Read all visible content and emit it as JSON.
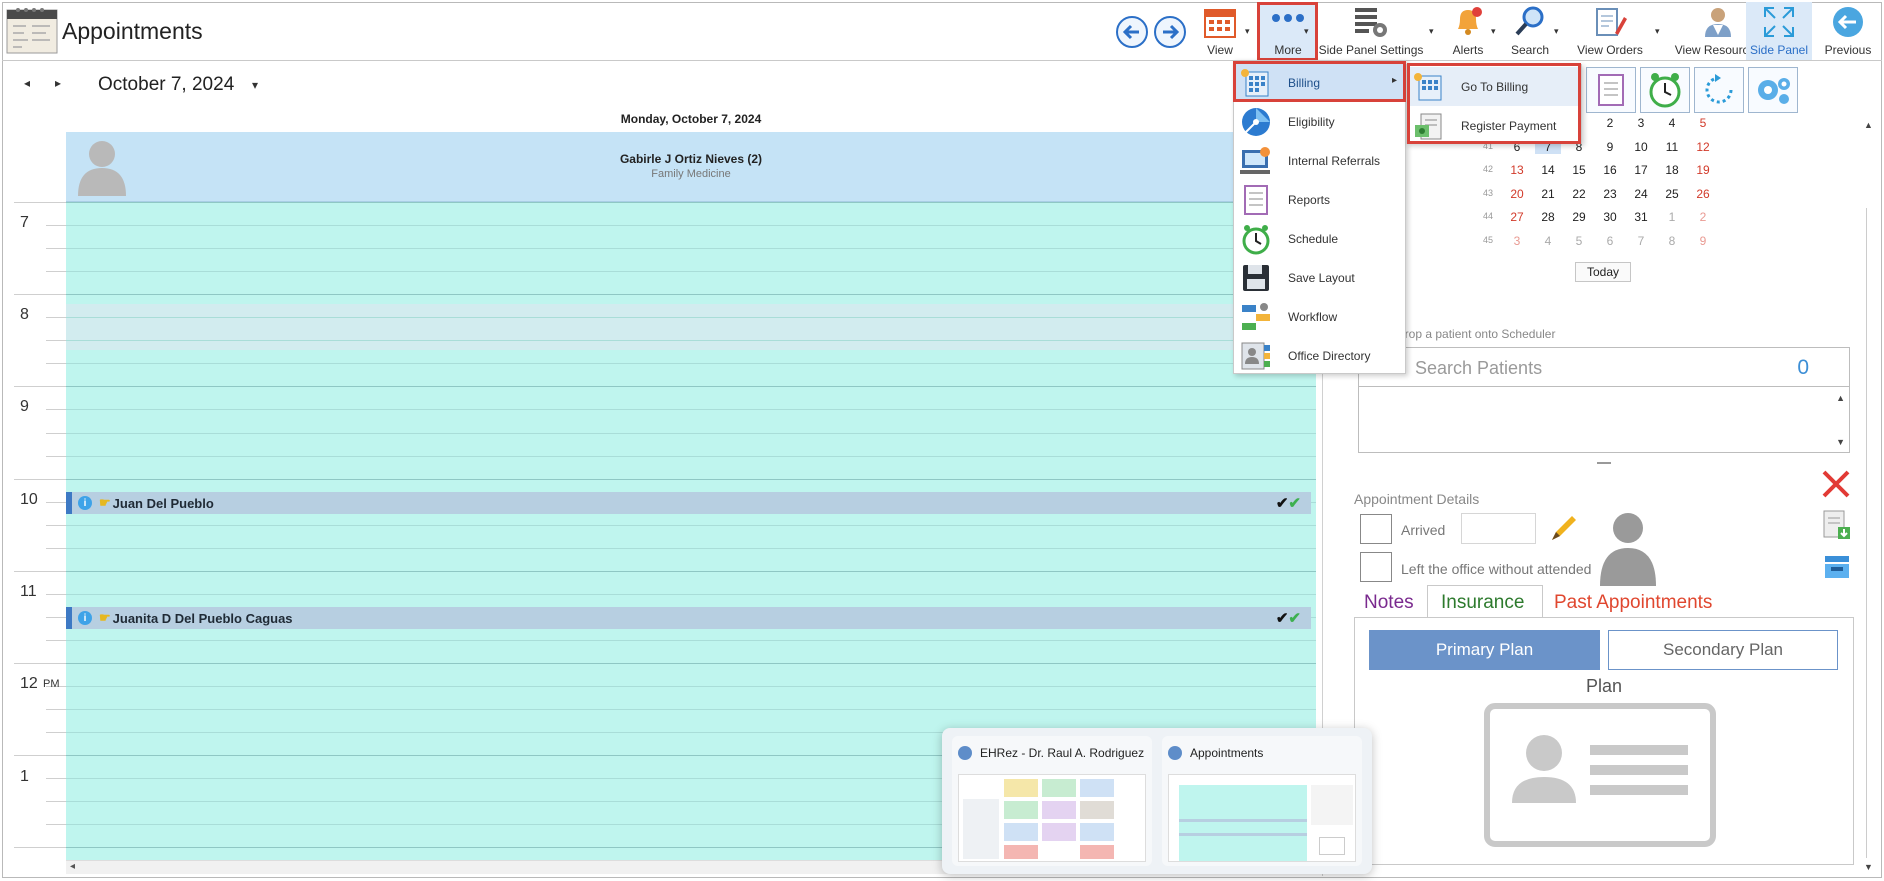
{
  "window": {
    "title": "Appointments"
  },
  "toolbar": {
    "view_label": "View",
    "more_label": "More",
    "side_panel_settings_label": "Side Panel Settings",
    "alerts_label": "Alerts",
    "search_label": "Search",
    "view_orders_label": "View Orders",
    "view_resources_label": "View Resources",
    "side_panel_label": "Side Panel",
    "previous_label": "Previous"
  },
  "date_nav": {
    "prev": "◂",
    "next": "▸",
    "current_date": "October 7, 2024",
    "caret": "▾"
  },
  "calendar": {
    "day_header": "Monday, October 7, 2024",
    "resource_name": "Gabirle J Ortiz Nieves (2)",
    "resource_specialty": "Family Medicine",
    "hours": [
      {
        "label": "7",
        "suffix": ""
      },
      {
        "label": "8",
        "suffix": ""
      },
      {
        "label": "9",
        "suffix": ""
      },
      {
        "label": "10",
        "suffix": ""
      },
      {
        "label": "11",
        "suffix": ""
      },
      {
        "label": "12",
        "suffix": "PM"
      },
      {
        "label": "1",
        "suffix": ""
      }
    ],
    "appointments": [
      {
        "patient": "Juan Del Pueblo"
      },
      {
        "patient": "Juanita D Del Pueblo Caguas"
      }
    ]
  },
  "more_menu": {
    "items": [
      {
        "label": "Billing",
        "icon": "billing-icon"
      },
      {
        "label": "Eligibility",
        "icon": "eligibility-icon"
      },
      {
        "label": "Internal Referrals",
        "icon": "referrals-icon"
      },
      {
        "label": "Reports",
        "icon": "reports-icon"
      },
      {
        "label": "Schedule",
        "icon": "clock-icon"
      },
      {
        "label": "Save Layout",
        "icon": "floppy-icon"
      },
      {
        "label": "Workflow",
        "icon": "workflow-icon"
      },
      {
        "label": "Office Directory",
        "icon": "directory-icon"
      }
    ],
    "submenu_arrow": "▸"
  },
  "billing_submenu": {
    "items": [
      {
        "label": "Go To Billing"
      },
      {
        "label": "Register Payment"
      }
    ]
  },
  "mini_calendar": {
    "weeks": [
      {
        "wk": "",
        "days": [
          "",
          "",
          "2",
          "3",
          "4",
          "5"
        ]
      },
      {
        "wk": "41",
        "days": [
          "6",
          "7",
          "8",
          "9",
          "10",
          "11",
          "12"
        ]
      },
      {
        "wk": "42",
        "days": [
          "13",
          "14",
          "15",
          "16",
          "17",
          "18",
          "19"
        ]
      },
      {
        "wk": "43",
        "days": [
          "20",
          "21",
          "22",
          "23",
          "24",
          "25",
          "26"
        ]
      },
      {
        "wk": "44",
        "days": [
          "27",
          "28",
          "29",
          "30",
          "31",
          "1",
          "2"
        ]
      },
      {
        "wk": "45",
        "days": [
          "3",
          "4",
          "5",
          "6",
          "7",
          "8",
          "9"
        ]
      }
    ],
    "today_label": "Today"
  },
  "patient_search": {
    "hint": "d drop a patient onto Scheduler",
    "placeholder": "Search Patients",
    "count": "0"
  },
  "appointment_details": {
    "heading": "Appointment Details",
    "arrived_label": "Arrived",
    "left_label": "Left the office without attended"
  },
  "tabs": {
    "notes": "Notes",
    "insurance": "Insurance",
    "past_appointments": "Past Appointments"
  },
  "plans": {
    "primary": "Primary Plan",
    "secondary": "Secondary Plan",
    "plan_label": "Plan"
  },
  "taskbar": {
    "window1_title": "EHRez - Dr. Raul A. Rodriguez ...",
    "window2_title": "Appointments"
  },
  "colors": {
    "accent_blue": "#3d79c4",
    "grid_teal": "#bff5ee",
    "highlight_red": "#d8423a",
    "weekend_red": "#d23a2a"
  }
}
